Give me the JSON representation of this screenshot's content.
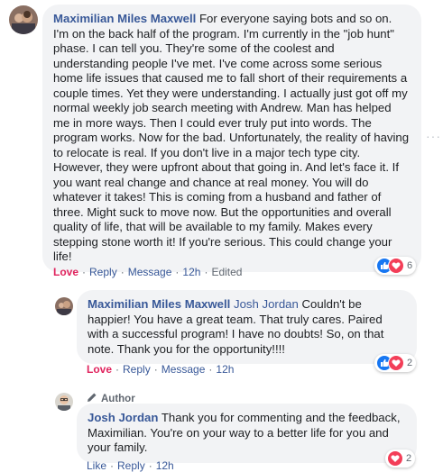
{
  "comments": [
    {
      "author": "Maximilian Miles Maxwell",
      "text": " For everyone saying bots and so on. I'm on the back half of the program. I'm currently in the \"job hunt\" phase. I can tell you. They're some of the coolest and understanding people I've met. I've come across some serious home life issues that caused me to fall short of their requirements a couple times. Yet they were understanding. I actually just got off my normal weekly job search meeting with Andrew. Man has helped me in more ways. Then I could ever truly put into words. The program works. Now for the bad. Unfortunately, the reality of having to relocate is real. If you don't live in a major tech type city. However, they were upfront about that going in. And let's face it. If you want real change and chance at real money. You will do whatever it takes! This is coming from a husband and father of three. Might suck to move now. But the opportunities and overall quality of life, that will be available to my family. Makes every stepping stone worth it! If you're serious. This could change your life!",
      "actions": {
        "love": "Love",
        "reply": "Reply",
        "message": "Message",
        "time": "12h",
        "edited": "Edited"
      },
      "reaction_count": "6",
      "more_label": "···"
    },
    {
      "author": "Maximilian Miles Maxwell",
      "mention": "Josh Jordan",
      "text": " Couldn't be happier! You have a great team. That truly cares. Paired with a successful program! I have no doubts! So, on that note. Thank you for the opportunity!!!!",
      "actions": {
        "love": "Love",
        "reply": "Reply",
        "message": "Message",
        "time": "12h"
      },
      "reaction_count": "2"
    },
    {
      "badge": "Author",
      "author": "Josh Jordan",
      "text": " Thank you for commenting and the feedback, Maximilian. You're on your way to a better life for you and your family.",
      "actions": {
        "like": "Like",
        "reply": "Reply",
        "time": "12h"
      },
      "reaction_count": "2"
    }
  ],
  "colors": {
    "link": "#385898",
    "love": "#e0245e",
    "bubble": "#f2f3f5",
    "like_blue": "#1877f2",
    "heart_red": "#f33e58"
  }
}
